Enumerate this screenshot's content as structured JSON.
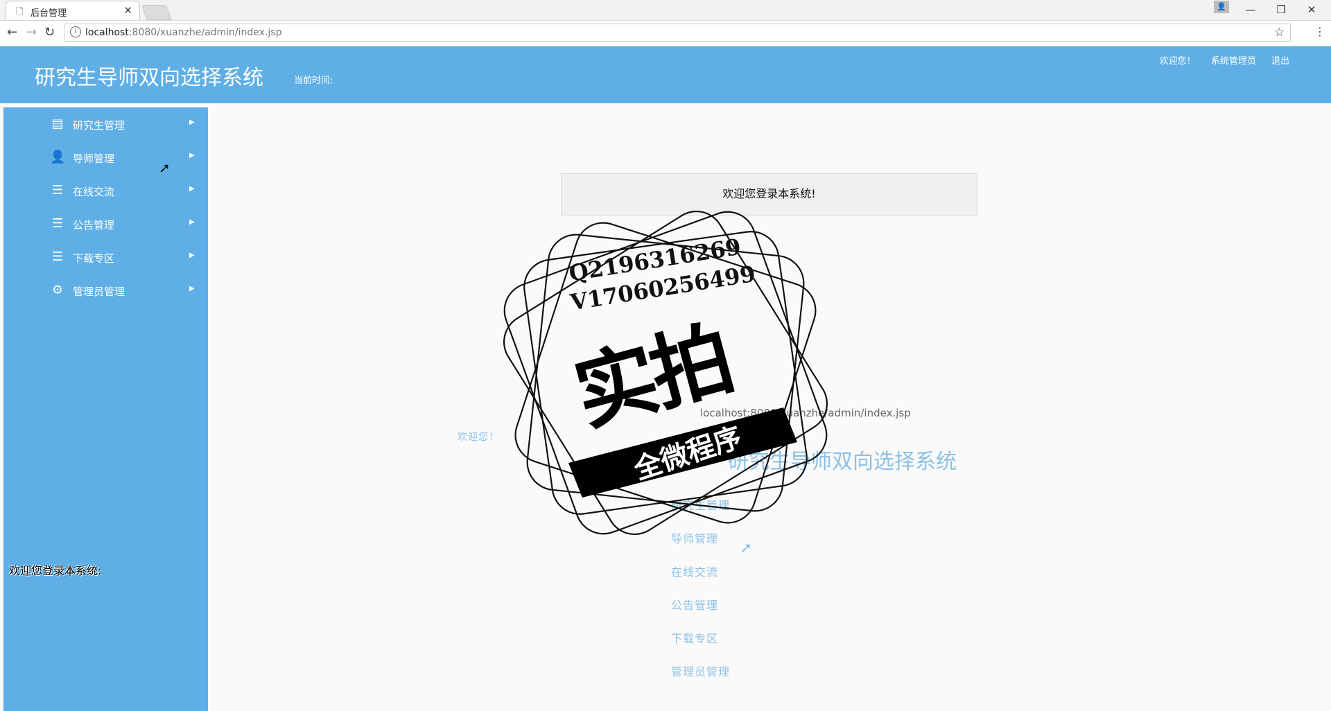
{
  "browser": {
    "tab_title": "后台管理",
    "tab_close": "✕",
    "url_host": "localhost",
    "url_rest": ":8080/xuanzhe/admin/index.jsp"
  },
  "header": {
    "title": "研究生导师双向选择系统",
    "time_label": "当前时间:",
    "welcome": "欢迎您！",
    "role": "系统管理员",
    "logout": "退出"
  },
  "sidebar": {
    "items": [
      {
        "label": "研究生管理",
        "icon": "book-icon"
      },
      {
        "label": "导师管理",
        "icon": "user-gear-icon"
      },
      {
        "label": "在线交流",
        "icon": "stack-icon"
      },
      {
        "label": "公告管理",
        "icon": "stack-icon"
      },
      {
        "label": "下载专区",
        "icon": "stack-icon"
      },
      {
        "label": "管理员管理",
        "icon": "gear-icon"
      }
    ],
    "welcome_text": "欢迎您登录本系统:"
  },
  "main": {
    "welcome_message": "欢迎您登录本系统!"
  },
  "watermark": {
    "line1": "Q2196316269",
    "line2": "V17060256499",
    "big": "实拍",
    "banner": "全微程序"
  },
  "ghost": {
    "url": "localhost:8080/xuanzhe/admin/index.jsp"
  },
  "colors": {
    "brand": "#5fafe6"
  }
}
